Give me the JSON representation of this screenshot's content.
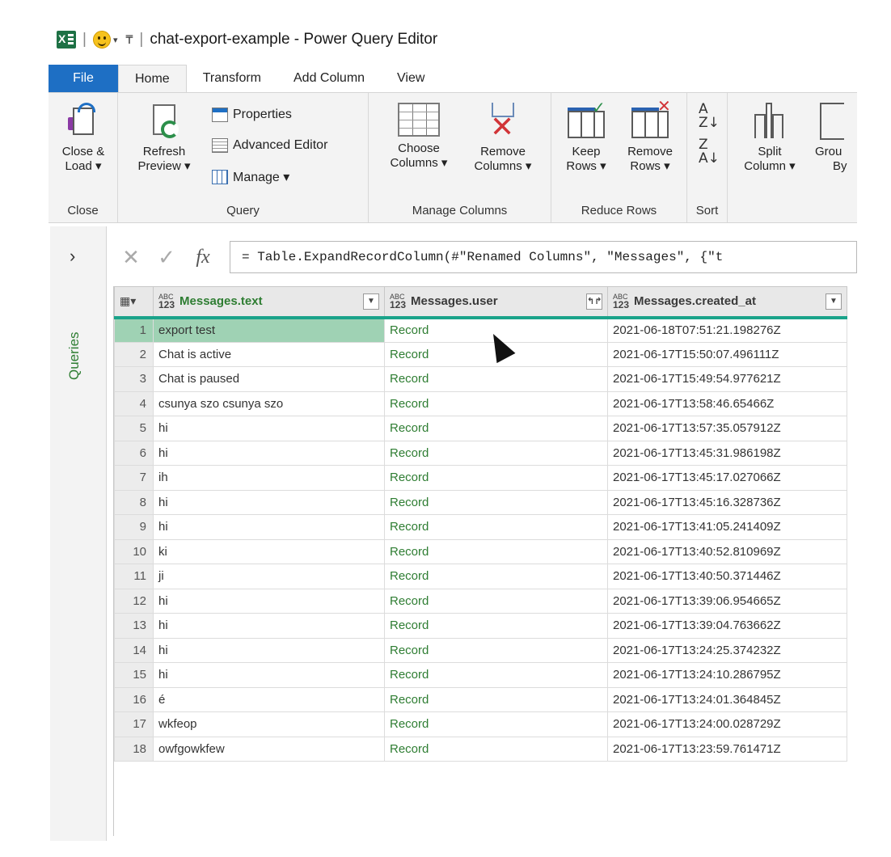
{
  "window": {
    "title": "chat-export-example - Power Query Editor"
  },
  "tabs": [
    "File",
    "Home",
    "Transform",
    "Add Column",
    "View"
  ],
  "ribbon": {
    "close_group": {
      "label": "Close",
      "close_load_line1": "Close &",
      "close_load_line2": "Load ▾"
    },
    "query_group": {
      "label": "Query",
      "refresh_line1": "Refresh",
      "refresh_line2": "Preview ▾",
      "properties": "Properties",
      "advanced_editor": "Advanced Editor",
      "manage": "Manage ▾"
    },
    "manage_columns_group": {
      "label": "Manage Columns",
      "choose_line1": "Choose",
      "choose_line2": "Columns ▾",
      "remove_line1": "Remove",
      "remove_line2": "Columns ▾"
    },
    "reduce_rows_group": {
      "label": "Reduce Rows",
      "keep_line1": "Keep",
      "keep_line2": "Rows ▾",
      "remove_line1": "Remove",
      "remove_line2": "Rows ▾"
    },
    "sort_group": {
      "label": "Sort"
    },
    "transform_group": {
      "split_line1": "Split",
      "split_line2": "Column ▾",
      "group_line1": "Grou",
      "group_line2": "By"
    }
  },
  "queries_pane": {
    "label": "Queries"
  },
  "formula_bar": {
    "fx": "fx",
    "formula": "= Table.ExpandRecordColumn(#\"Renamed Columns\", \"Messages\", {\"t"
  },
  "columns": [
    "Messages.text",
    "Messages.user",
    "Messages.created_at"
  ],
  "rows": [
    {
      "n": "1",
      "text": "export test",
      "user": "Record",
      "created_at": "2021-06-18T07:51:21.198276Z"
    },
    {
      "n": "2",
      "text": "Chat is active",
      "user": "Record",
      "created_at": "2021-06-17T15:50:07.496111Z"
    },
    {
      "n": "3",
      "text": "Chat is paused",
      "user": "Record",
      "created_at": "2021-06-17T15:49:54.977621Z"
    },
    {
      "n": "4",
      "text": "csunya szo csunya szo",
      "user": "Record",
      "created_at": "2021-06-17T13:58:46.65466Z"
    },
    {
      "n": "5",
      "text": "hi",
      "user": "Record",
      "created_at": "2021-06-17T13:57:35.057912Z"
    },
    {
      "n": "6",
      "text": "hi",
      "user": "Record",
      "created_at": "2021-06-17T13:45:31.986198Z"
    },
    {
      "n": "7",
      "text": "ih",
      "user": "Record",
      "created_at": "2021-06-17T13:45:17.027066Z"
    },
    {
      "n": "8",
      "text": "hi",
      "user": "Record",
      "created_at": "2021-06-17T13:45:16.328736Z"
    },
    {
      "n": "9",
      "text": "hi",
      "user": "Record",
      "created_at": "2021-06-17T13:41:05.241409Z"
    },
    {
      "n": "10",
      "text": "ki",
      "user": "Record",
      "created_at": "2021-06-17T13:40:52.810969Z"
    },
    {
      "n": "11",
      "text": "ji",
      "user": "Record",
      "created_at": "2021-06-17T13:40:50.371446Z"
    },
    {
      "n": "12",
      "text": "hi",
      "user": "Record",
      "created_at": "2021-06-17T13:39:06.954665Z"
    },
    {
      "n": "13",
      "text": "hi",
      "user": "Record",
      "created_at": "2021-06-17T13:39:04.763662Z"
    },
    {
      "n": "14",
      "text": "hi",
      "user": "Record",
      "created_at": "2021-06-17T13:24:25.374232Z"
    },
    {
      "n": "15",
      "text": "hi",
      "user": "Record",
      "created_at": "2021-06-17T13:24:10.286795Z"
    },
    {
      "n": "16",
      "text": "é",
      "user": "Record",
      "created_at": "2021-06-17T13:24:01.364845Z"
    },
    {
      "n": "17",
      "text": "wkfeop",
      "user": "Record",
      "created_at": "2021-06-17T13:24:00.028729Z"
    },
    {
      "n": "18",
      "text": "owfgowkfew",
      "user": "Record",
      "created_at": "2021-06-17T13:23:59.761471Z"
    }
  ],
  "colors": {
    "accent_file": "#1e6fc4",
    "record_green": "#2e7d32",
    "selection": "#9fd2b4",
    "header_line": "#1aa38a"
  }
}
